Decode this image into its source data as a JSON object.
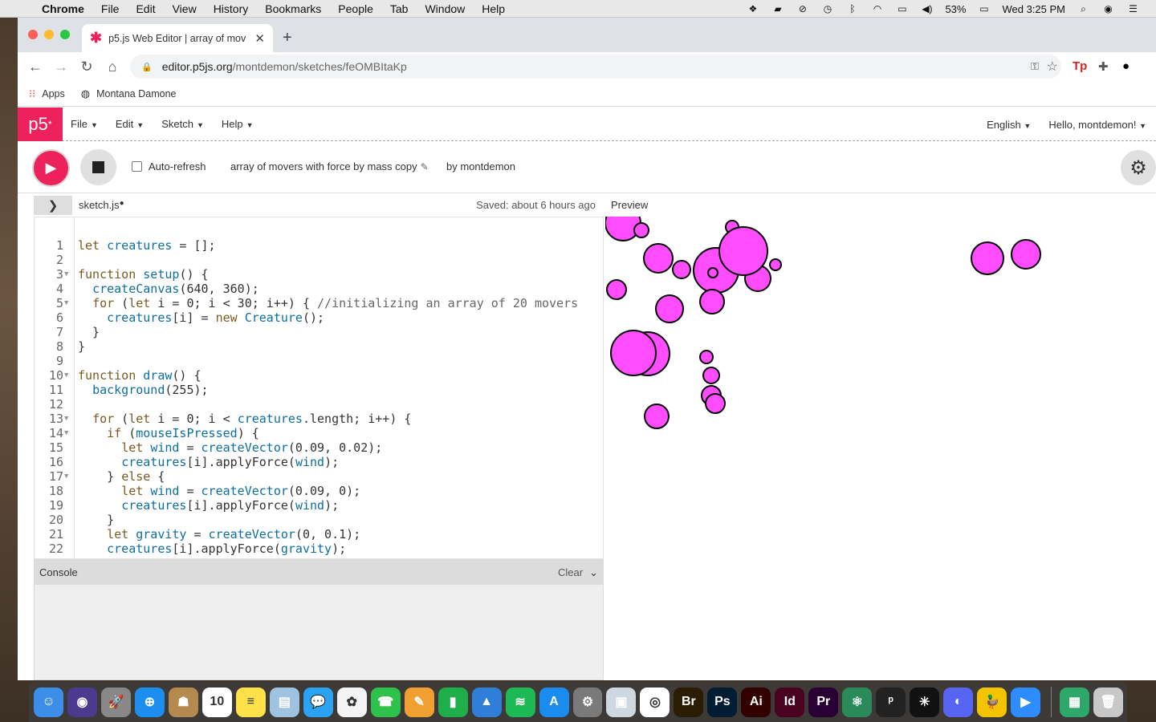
{
  "menubar": {
    "app": "Chrome",
    "items": [
      "File",
      "Edit",
      "View",
      "History",
      "Bookmarks",
      "People",
      "Tab",
      "Window",
      "Help"
    ],
    "battery": "53%",
    "clock": "Wed 3:25 PM"
  },
  "browser": {
    "tab_title": "p5.js Web Editor | array of mov",
    "url_host": "editor.p5js.org",
    "url_path": "/montdemon/sketches/feOMBItaKp",
    "bookmarks": [
      {
        "label": "Apps",
        "icon": "apps-grid-icon"
      },
      {
        "label": "Montana Damone",
        "icon": "globe-icon"
      }
    ]
  },
  "p5": {
    "logo": "p5",
    "menus": [
      "File",
      "Edit",
      "Sketch",
      "Help"
    ],
    "language": "English",
    "greeting": "Hello, montdemon!",
    "auto_refresh_label": "Auto-refresh",
    "auto_refresh_checked": false,
    "sketch_name": "array of movers with force by mass copy",
    "by_user": "by montdemon",
    "file_name": "sketch.js",
    "saved_status": "Saved: about 6 hours ago",
    "preview_label": "Preview",
    "console_label": "Console",
    "clear_label": "Clear"
  },
  "code_lines": [
    {
      "n": "1",
      "fold": false,
      "text": "let creatures = [];"
    },
    {
      "n": "2",
      "fold": false,
      "text": ""
    },
    {
      "n": "3",
      "fold": true,
      "text": "function setup() {"
    },
    {
      "n": "4",
      "fold": false,
      "text": "  createCanvas(640, 360);"
    },
    {
      "n": "5",
      "fold": true,
      "text": "  for (let i = 0; i < 30; i++) { //initializing an array of 20 movers"
    },
    {
      "n": "6",
      "fold": false,
      "text": "    creatures[i] = new Creature();"
    },
    {
      "n": "7",
      "fold": false,
      "text": "  }"
    },
    {
      "n": "8",
      "fold": false,
      "text": "}"
    },
    {
      "n": "9",
      "fold": false,
      "text": ""
    },
    {
      "n": "10",
      "fold": true,
      "text": "function draw() {"
    },
    {
      "n": "11",
      "fold": false,
      "text": "  background(255);"
    },
    {
      "n": "12",
      "fold": false,
      "text": ""
    },
    {
      "n": "13",
      "fold": true,
      "text": "  for (let i = 0; i < creatures.length; i++) {"
    },
    {
      "n": "14",
      "fold": true,
      "text": "    if (mouseIsPressed) {"
    },
    {
      "n": "15",
      "fold": false,
      "text": "      let wind = createVector(0.09, 0.02);"
    },
    {
      "n": "16",
      "fold": false,
      "text": "      creatures[i].applyForce(wind);"
    },
    {
      "n": "17",
      "fold": true,
      "text": "    } else {"
    },
    {
      "n": "18",
      "fold": false,
      "text": "      let wind = createVector(0.09, 0);"
    },
    {
      "n": "19",
      "fold": false,
      "text": "      creatures[i].applyForce(wind);"
    },
    {
      "n": "20",
      "fold": false,
      "text": "    }"
    },
    {
      "n": "21",
      "fold": false,
      "text": "    let gravity = createVector(0, 0.1);"
    },
    {
      "n": "22",
      "fold": false,
      "text": "    creatures[i].applyForce(gravity);"
    }
  ],
  "canvas": {
    "fill": "#ff4cff",
    "stroke": "#000000",
    "circles": [
      [
        22,
        8,
        22
      ],
      [
        45,
        17,
        9
      ],
      [
        66,
        52,
        18
      ],
      [
        95,
        66,
        11
      ],
      [
        138,
        67,
        28
      ],
      [
        134,
        70,
        6
      ],
      [
        190,
        77,
        16
      ],
      [
        133,
        106,
        15
      ],
      [
        158,
        13,
        8
      ],
      [
        212,
        60,
        7
      ],
      [
        172,
        43,
        30
      ],
      [
        14,
        91,
        12
      ],
      [
        80,
        115,
        17
      ],
      [
        53,
        171,
        27
      ],
      [
        35,
        170,
        28
      ],
      [
        126,
        175,
        8
      ],
      [
        132,
        198,
        10
      ],
      [
        132,
        223,
        12
      ],
      [
        137,
        233,
        12
      ],
      [
        64,
        249,
        15
      ],
      [
        476,
        52,
        20
      ],
      [
        524,
        47,
        18
      ]
    ]
  },
  "dock": {
    "apps": [
      {
        "name": "finder",
        "label": "☺",
        "bg": "#3c8ee8"
      },
      {
        "name": "siri",
        "label": "◉",
        "bg": "#4b3b8f"
      },
      {
        "name": "launchpad",
        "label": "🚀",
        "bg": "#888888"
      },
      {
        "name": "safari",
        "label": "⊕",
        "bg": "#1c8ef0"
      },
      {
        "name": "contacts",
        "label": "☗",
        "bg": "#b58a4f"
      },
      {
        "name": "calendar",
        "label": "10",
        "bg": "#ffffff"
      },
      {
        "name": "notes",
        "label": "≡",
        "bg": "#ffe24a"
      },
      {
        "name": "preview",
        "label": "▤",
        "bg": "#9ec3e0"
      },
      {
        "name": "messages",
        "label": "💬",
        "bg": "#2aa3f5"
      },
      {
        "name": "photos",
        "label": "✿",
        "bg": "#f4f4f4"
      },
      {
        "name": "facetime",
        "label": "☎",
        "bg": "#2fc24b"
      },
      {
        "name": "pages",
        "label": "✎",
        "bg": "#f0a030"
      },
      {
        "name": "numbers",
        "label": "▮",
        "bg": "#1fae4a"
      },
      {
        "name": "keynote",
        "label": "▲",
        "bg": "#2f7fd8"
      },
      {
        "name": "spotify",
        "label": "≋",
        "bg": "#1db954"
      },
      {
        "name": "app-store",
        "label": "A",
        "bg": "#1a8cf0"
      },
      {
        "name": "system-preferences",
        "label": "⚙",
        "bg": "#7a7a7a"
      },
      {
        "name": "photo-viewer",
        "label": "▣",
        "bg": "#cfd8e0"
      },
      {
        "name": "chrome",
        "label": "◎",
        "bg": "#ffffff"
      },
      {
        "name": "bridge",
        "label": "Br",
        "bg": "#2b1c04"
      },
      {
        "name": "photoshop",
        "label": "Ps",
        "bg": "#001d34"
      },
      {
        "name": "illustrator",
        "label": "Ai",
        "bg": "#330000"
      },
      {
        "name": "indesign",
        "label": "Id",
        "bg": "#49021f"
      },
      {
        "name": "premiere",
        "label": "Pr",
        "bg": "#2a0034"
      },
      {
        "name": "atom",
        "label": "⚛",
        "bg": "#2b8a5a"
      },
      {
        "name": "p5",
        "label": "ᵖ",
        "bg": "#222222"
      },
      {
        "name": "splash",
        "label": "✳",
        "bg": "#111111"
      },
      {
        "name": "discord",
        "label": "◐",
        "bg": "#5865f2"
      },
      {
        "name": "cyberduck",
        "label": "🦆",
        "bg": "#f5c400"
      },
      {
        "name": "zoom",
        "label": "▶",
        "bg": "#2d8cff"
      },
      {
        "name": "documents",
        "label": "▦",
        "bg": "#2da86a"
      },
      {
        "name": "trash",
        "label": "🗑",
        "bg": "#c8c8c8"
      }
    ]
  }
}
